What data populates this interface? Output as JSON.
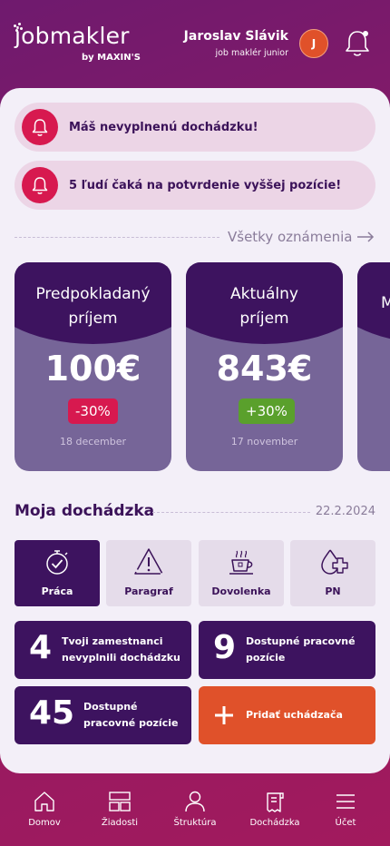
{
  "header": {
    "logo_word": "jobmakler",
    "logo_by": "by MAXIN'S",
    "user_name": "Jaroslav Slávik",
    "user_role": "job maklér junior",
    "avatar_initial": "J"
  },
  "notifications": [
    {
      "text": "Máš nevyplnenú dochádzku!",
      "icon": "bell-icon"
    },
    {
      "text": "5 ľudí čaká na potvrdenie vyššej pozície!",
      "icon": "bell-icon"
    }
  ],
  "all_notifications_label": "Všetky oznámenia",
  "income_cards": [
    {
      "title_line1": "Predpokladaný",
      "title_line2": "príjem",
      "amount": "100€",
      "change": "-30%",
      "change_color": "#d7194f",
      "date": "18 december"
    },
    {
      "title_line1": "Aktuálny",
      "title_line2": "príjem",
      "amount": "843€",
      "change": "+30%",
      "change_color": "#5aa02c",
      "date": "17 november"
    },
    {
      "title_line1": "M",
      "title_line2": "",
      "amount": "",
      "change": "",
      "change_color": "",
      "date": ""
    }
  ],
  "attendance": {
    "title": "Moja dochádzka",
    "date": "22.2.2024",
    "tabs": [
      {
        "label": "Práca",
        "icon": "stopwatch-check-icon",
        "active": true
      },
      {
        "label": "Paragraf",
        "icon": "warning-icon",
        "active": false
      },
      {
        "label": "Dovolenka",
        "icon": "coffee-cup-icon",
        "active": false
      },
      {
        "label": "PN",
        "icon": "drop-plus-icon",
        "active": false
      }
    ]
  },
  "stats": [
    {
      "number": "4",
      "label_line1": "Tvoji zamestnanci",
      "label_line2": "nevyplnili dochádzku"
    },
    {
      "number": "9",
      "label_line1": "Dostupné pracovné",
      "label_line2": "pozície"
    },
    {
      "number": "45",
      "label_line1": "Dostupné",
      "label_line2": "pracovné pozície"
    }
  ],
  "add_button_label": "Pridať uchádzača",
  "bottom_nav": [
    {
      "label": "Domov",
      "icon": "home-icon"
    },
    {
      "label": "Žiadosti",
      "icon": "requests-icon"
    },
    {
      "label": "Štruktúra",
      "icon": "user-icon"
    },
    {
      "label": "Dochádzka",
      "icon": "document-icon"
    },
    {
      "label": "Účet",
      "icon": "menu-icon"
    }
  ],
  "colors": {
    "primary_dark": "#3d135f",
    "accent_red": "#d7194f",
    "accent_orange": "#e0512a",
    "positive_green": "#5aa02c"
  }
}
